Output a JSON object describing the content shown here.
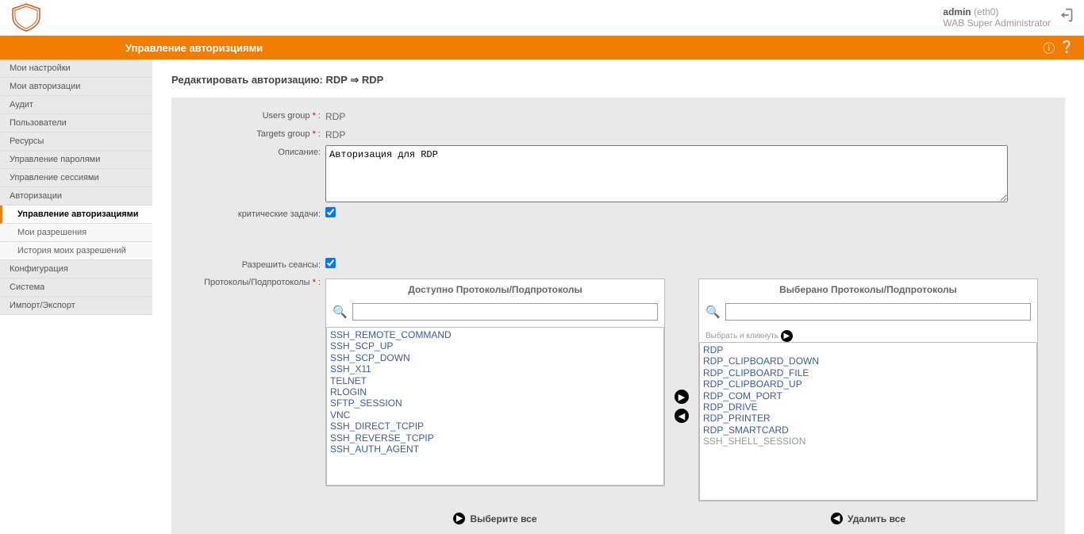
{
  "user": {
    "name": "admin",
    "iface": "(eth0)",
    "role": "WAB Super Administrator"
  },
  "breadcrumb": "Управление авторизциями",
  "sidebar": {
    "items": [
      {
        "label": "Мои настройки"
      },
      {
        "label": "Мои авторизации"
      },
      {
        "label": "Аудит"
      },
      {
        "label": "Пользователи"
      },
      {
        "label": "Ресурсы"
      },
      {
        "label": "Управление паролями"
      },
      {
        "label": "Управление сессиями"
      },
      {
        "label": "Авторизации"
      },
      {
        "label": "Управление авторизациями",
        "sub": true,
        "sel": true
      },
      {
        "label": "Мои разрешения",
        "sub": true
      },
      {
        "label": "История моих разрешений",
        "sub": true
      },
      {
        "label": "Конфигурация"
      },
      {
        "label": "Система"
      },
      {
        "label": "Импорт/Экспорт"
      }
    ]
  },
  "page": {
    "title": "Редактировать авторизацию: RDP ⇒ RDP",
    "labels": {
      "users_group": "Users group",
      "targets_group": "Targets group",
      "description": "Описание:",
      "critical": "критические задачи:",
      "allow_sessions": "Разрешить сеансы:",
      "protocols": "Протоколы/Подпротоколы"
    },
    "values": {
      "users_group": "RDP",
      "targets_group": "RDP",
      "description": "Авторизация для RDP"
    }
  },
  "dual": {
    "available_header": "Доступно Протоколы/Подпротоколы",
    "selected_header": "Выберано Протоколы/Подпротоколы",
    "hint": "Выбрать и кликнуть",
    "available": [
      "SSH_REMOTE_COMMAND",
      "SSH_SCP_UP",
      "SSH_SCP_DOWN",
      "SSH_X11",
      "TELNET",
      "RLOGIN",
      "SFTP_SESSION",
      "VNC",
      "SSH_DIRECT_TCPIP",
      "SSH_REVERSE_TCPIP",
      "SSH_AUTH_AGENT"
    ],
    "selected": [
      {
        "v": "RDP"
      },
      {
        "v": "RDP_CLIPBOARD_DOWN"
      },
      {
        "v": "RDP_CLIPBOARD_FILE"
      },
      {
        "v": "RDP_CLIPBOARD_UP"
      },
      {
        "v": "RDP_COM_PORT"
      },
      {
        "v": "RDP_DRIVE"
      },
      {
        "v": "RDP_PRINTER"
      },
      {
        "v": "RDP_SMARTCARD"
      },
      {
        "v": "SSH_SHELL_SESSION",
        "gray": true
      }
    ],
    "select_all": "Выберите все",
    "remove_all": "Удалить все"
  }
}
